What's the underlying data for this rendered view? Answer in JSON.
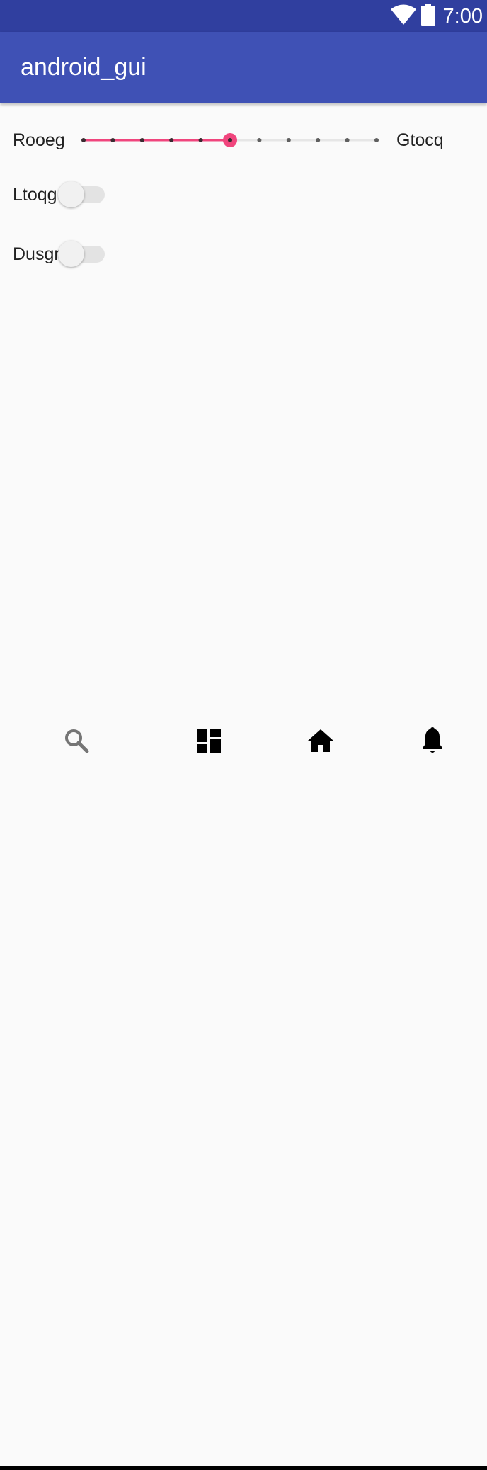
{
  "status_bar": {
    "time": "7:00",
    "icons": [
      "wifi-icon",
      "battery-icon"
    ]
  },
  "app_bar": {
    "title": "android_gui"
  },
  "seekbar": {
    "min_label": "Rooeg",
    "max_label": "Gtocq",
    "steps": 10,
    "value": 5,
    "accent_color": "#f0457d",
    "tick_color": "#5f5f5f",
    "track_color": "#e6e6e6"
  },
  "switches": [
    {
      "label": "Ltoqg",
      "checked": false
    },
    {
      "label": "Dusgr",
      "checked": false
    }
  ],
  "bottom_nav": {
    "items": [
      {
        "icon": "search-icon",
        "color": "#757575"
      },
      {
        "icon": "dashboard-icon",
        "color": "#000000"
      },
      {
        "icon": "home-icon",
        "color": "#000000"
      },
      {
        "icon": "bell-icon",
        "color": "#000000"
      }
    ]
  },
  "colors": {
    "status_bar": "#303f9f",
    "app_bar": "#3f51b5",
    "background": "#fafafa"
  }
}
